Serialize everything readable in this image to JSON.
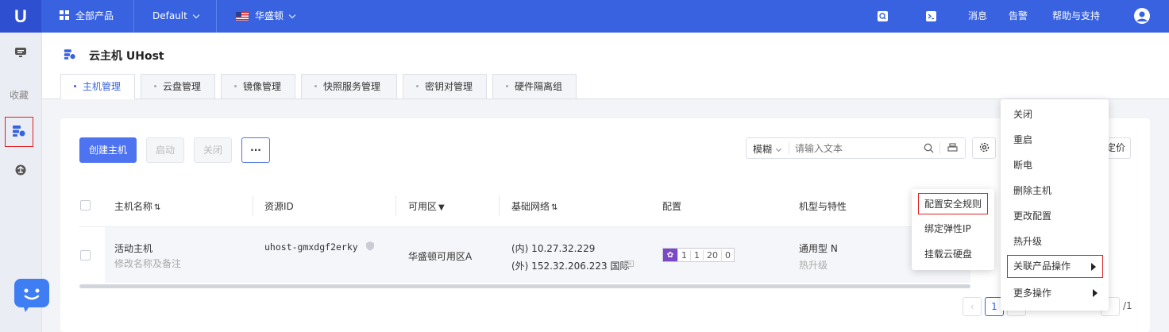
{
  "topbar": {
    "logo": "U",
    "all_products": "全部产品",
    "project": "Default",
    "region": "华盛顿",
    "messages": "消息",
    "alerts": "告警",
    "help": "帮助与支持"
  },
  "sidebar": {
    "favorites": "收藏"
  },
  "page": {
    "title": "云主机 UHost"
  },
  "tabs": [
    "主机管理",
    "云盘管理",
    "镜像管理",
    "快照服务管理",
    "密钥对管理",
    "硬件隔离组"
  ],
  "toolbar": {
    "create": "创建主机",
    "start": "启动",
    "stop": "关闭",
    "more": "···",
    "search_mode": "模糊",
    "search_placeholder": "请输入文本",
    "pricing_partial": "定价"
  },
  "table": {
    "headers": [
      "主机名称",
      "资源ID",
      "可用区",
      "基础网络",
      "配置",
      "机型与特性"
    ],
    "row": {
      "name": "活动主机",
      "name_hint": "修改名称及备注",
      "resource_id": "uhost-gmxdgf2erky",
      "zone": "华盛顿可用区A",
      "ip_internal": "(内) 10.27.32.229",
      "ip_external": "(外) 152.32.206.223 国际",
      "spec": [
        "1",
        "1",
        "20",
        "0"
      ],
      "type": "通用型 N",
      "upgrade": "热升级"
    }
  },
  "submenu": {
    "items": [
      "配置安全规则",
      "绑定弹性IP",
      "挂载云硬盘"
    ]
  },
  "main_menu": {
    "items": [
      "关闭",
      "重启",
      "断电",
      "删除主机",
      "更改配置",
      "热升级",
      "关联产品操作",
      "更多操作"
    ]
  },
  "pagination": {
    "current": "1",
    "total": "/1"
  },
  "colors": {
    "primary": "#3862e0",
    "highlight": "#e02020",
    "spec_icon": "#7b48c8"
  }
}
